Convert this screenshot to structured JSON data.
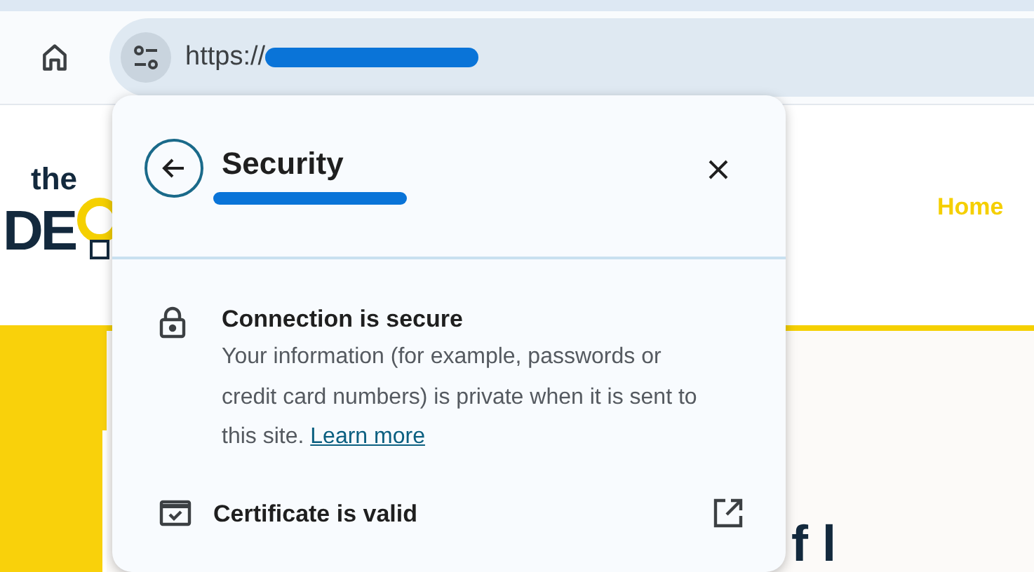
{
  "toolbar": {
    "url": "https://"
  },
  "page": {
    "logo": [
      "the",
      "DE"
    ],
    "nav": [
      "Home"
    ],
    "heading": "f l"
  },
  "security_popup": {
    "title": "Security",
    "connection": {
      "title": "Connection is secure",
      "text": "Your information (for example, passwords or credit card numbers) is private when it is sent to this site.",
      "link": "Learn more"
    },
    "certificate": {
      "label": "Certificate is valid"
    }
  }
}
